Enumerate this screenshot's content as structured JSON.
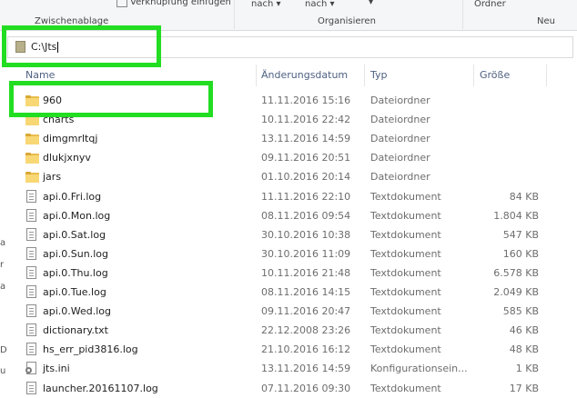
{
  "ribbon": {
    "clipboard_group": "Zwischenablage",
    "paste_shortcut": "Verknüpfung einfügen",
    "move_to": "nach",
    "copy_to": "nach",
    "organize_group": "Organisieren",
    "new_folder": "Ordner",
    "new_group": "Neu"
  },
  "address": {
    "path": "C:\\Jts"
  },
  "columns": {
    "name": "Name",
    "date": "Änderungsdatum",
    "type": "Typ",
    "size": "Größe"
  },
  "nav_fragments": [
    "a",
    "r",
    "a",
    "D",
    "u"
  ],
  "files": [
    {
      "name": "960",
      "date": "11.11.2016 15:16",
      "type": "Dateiordner",
      "size": "",
      "icon": "folder-icon"
    },
    {
      "name": "charts",
      "date": "10.11.2016 22:42",
      "type": "Dateiordner",
      "size": "",
      "icon": "folder-icon"
    },
    {
      "name": "dimgmrltqj",
      "date": "13.11.2016 14:59",
      "type": "Dateiordner",
      "size": "",
      "icon": "folder-icon"
    },
    {
      "name": "dlukjxnyv",
      "date": "09.11.2016 20:51",
      "type": "Dateiordner",
      "size": "",
      "icon": "folder-icon"
    },
    {
      "name": "jars",
      "date": "01.10.2016 20:14",
      "type": "Dateiordner",
      "size": "",
      "icon": "folder-icon"
    },
    {
      "name": "api.0.Fri.log",
      "date": "11.11.2016 22:10",
      "type": "Textdokument",
      "size": "84 KB",
      "icon": "text-document-icon"
    },
    {
      "name": "api.0.Mon.log",
      "date": "08.11.2016 09:54",
      "type": "Textdokument",
      "size": "1.804 KB",
      "icon": "text-document-icon"
    },
    {
      "name": "api.0.Sat.log",
      "date": "30.10.2016 10:38",
      "type": "Textdokument",
      "size": "547 KB",
      "icon": "text-document-icon"
    },
    {
      "name": "api.0.Sun.log",
      "date": "30.10.2016 11:09",
      "type": "Textdokument",
      "size": "160 KB",
      "icon": "text-document-icon"
    },
    {
      "name": "api.0.Thu.log",
      "date": "10.11.2016 21:48",
      "type": "Textdokument",
      "size": "6.578 KB",
      "icon": "text-document-icon"
    },
    {
      "name": "api.0.Tue.log",
      "date": "08.11.2016 14:15",
      "type": "Textdokument",
      "size": "2.049 KB",
      "icon": "text-document-icon"
    },
    {
      "name": "api.0.Wed.log",
      "date": "09.11.2016 20:47",
      "type": "Textdokument",
      "size": "585 KB",
      "icon": "text-document-icon"
    },
    {
      "name": "dictionary.txt",
      "date": "22.12.2008 23:26",
      "type": "Textdokument",
      "size": "46 KB",
      "icon": "text-document-icon"
    },
    {
      "name": "hs_err_pid3816.log",
      "date": "21.10.2016 16:12",
      "type": "Textdokument",
      "size": "48 KB",
      "icon": "text-document-icon"
    },
    {
      "name": "jts.ini",
      "date": "13.11.2016 14:59",
      "type": "Konfigurationsein...",
      "size": "1 KB",
      "icon": "settings-file-icon"
    },
    {
      "name": "launcher.20161107.log",
      "date": "07.11.2016 09:30",
      "type": "Textdokument",
      "size": "17 KB",
      "icon": "text-document-icon"
    }
  ]
}
